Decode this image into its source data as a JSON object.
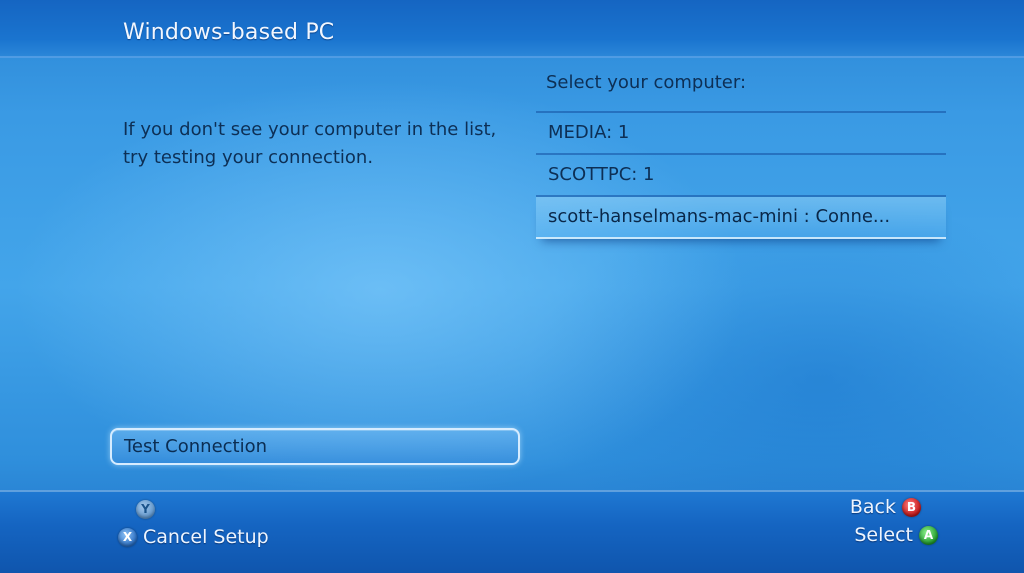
{
  "header": {
    "title": "Windows-based PC"
  },
  "main": {
    "hint": "If you don't see your computer in the list, try testing your connection.",
    "list_heading": "Select your computer:",
    "computers": [
      {
        "label": "MEDIA: 1",
        "selected": false
      },
      {
        "label": "SCOTTPC: 1",
        "selected": false
      },
      {
        "label": "scott-hanselmans-mac-mini : Conne...",
        "selected": true
      }
    ],
    "test_connection_label": "Test Connection"
  },
  "footer": {
    "y_button_glyph": "Y",
    "x_button_glyph": "X",
    "cancel_label": "Cancel Setup",
    "b_button_glyph": "B",
    "back_label": "Back",
    "a_button_glyph": "A",
    "select_label": "Select"
  },
  "colors": {
    "background_blue": "#2f8fdc",
    "bar_blue": "#1565c2",
    "text_dark": "#0d2f55",
    "text_light": "#eef5ff",
    "b_button_red": "#c41616",
    "a_button_green": "#1f9a2a",
    "x_button_blue": "#2a6fc4"
  }
}
